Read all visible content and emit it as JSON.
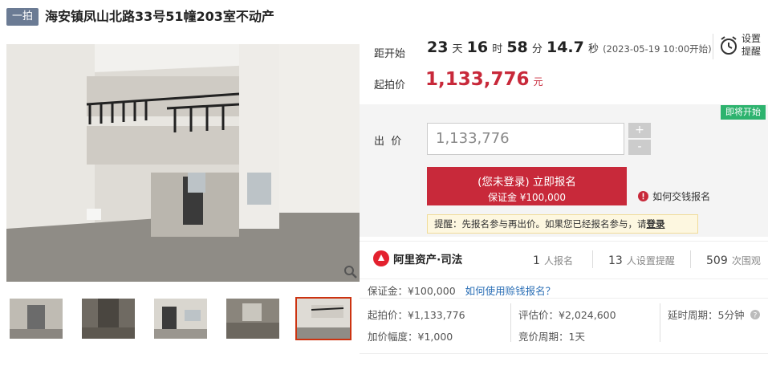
{
  "header": {
    "badge": "一拍",
    "title": "海安镇凤山北路33号51幢203室不动产"
  },
  "countdown": {
    "label": "距开始",
    "days": "23",
    "days_unit": "天",
    "hours": "16",
    "hours_unit": "时",
    "minutes": "58",
    "minutes_unit": "分",
    "seconds": "14.7",
    "seconds_unit": "秒",
    "start_note": "(2023-05-19 10:00开始)"
  },
  "reminder": {
    "line1": "设置",
    "line2": "提醒"
  },
  "start_price": {
    "label": "起拍价",
    "value": "1,133,776",
    "unit": "元"
  },
  "bid": {
    "status_badge": "即将开始",
    "label": "出  价",
    "input_value": "1,133,776",
    "plus": "+",
    "minus": "-",
    "signup_line1": "(您未登录) 立即报名",
    "signup_line2": "保证金 ¥100,000",
    "help_link": "如何交钱报名",
    "tip_text": "提醒：先报名参与再出价。如果您已经报名参与，请",
    "tip_login": "登录"
  },
  "stats": {
    "brand": "阿里资产·司法",
    "signups_count": "1",
    "signups_label": "人报名",
    "reminders_count": "13",
    "reminders_label": "人设置提醒",
    "views_count": "509",
    "views_label": "次围观"
  },
  "details": {
    "deposit": "保证金：¥100,000",
    "deposit_link": "如何使用赊钱报名？",
    "start_price": "起拍价：¥1,133,776",
    "appraisal": "评估价：¥2,024,600",
    "delay_period": "延时周期：5分钟",
    "increment": "加价幅度：¥1,000",
    "bid_period": "竞价周期：1天"
  },
  "colors": {
    "brand_red": "#c8293a",
    "badge_bg": "#6b7b94",
    "status_green": "#2db36e",
    "link_blue": "#2b6fb6"
  }
}
